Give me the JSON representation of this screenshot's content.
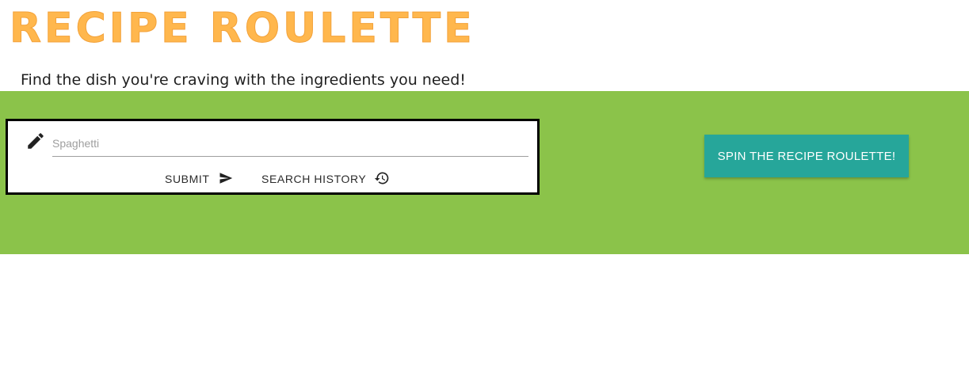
{
  "header": {
    "title": "RECIPE ROULETTE",
    "tagline": "Find the dish you're craving with the ingredients you need!"
  },
  "search": {
    "placeholder": "Spaghetti",
    "value": "",
    "icon": "pencil-icon",
    "submit_label": "SUBMIT",
    "submit_icon": "send-icon",
    "history_label": "SEARCH HISTORY",
    "history_icon": "history-icon"
  },
  "spin": {
    "label": "SPIN THE RECIPE ROULETTE!"
  },
  "colors": {
    "title": "#ffb74d",
    "hero_background": "#8bc34a",
    "spin_button": "#26a69a"
  }
}
